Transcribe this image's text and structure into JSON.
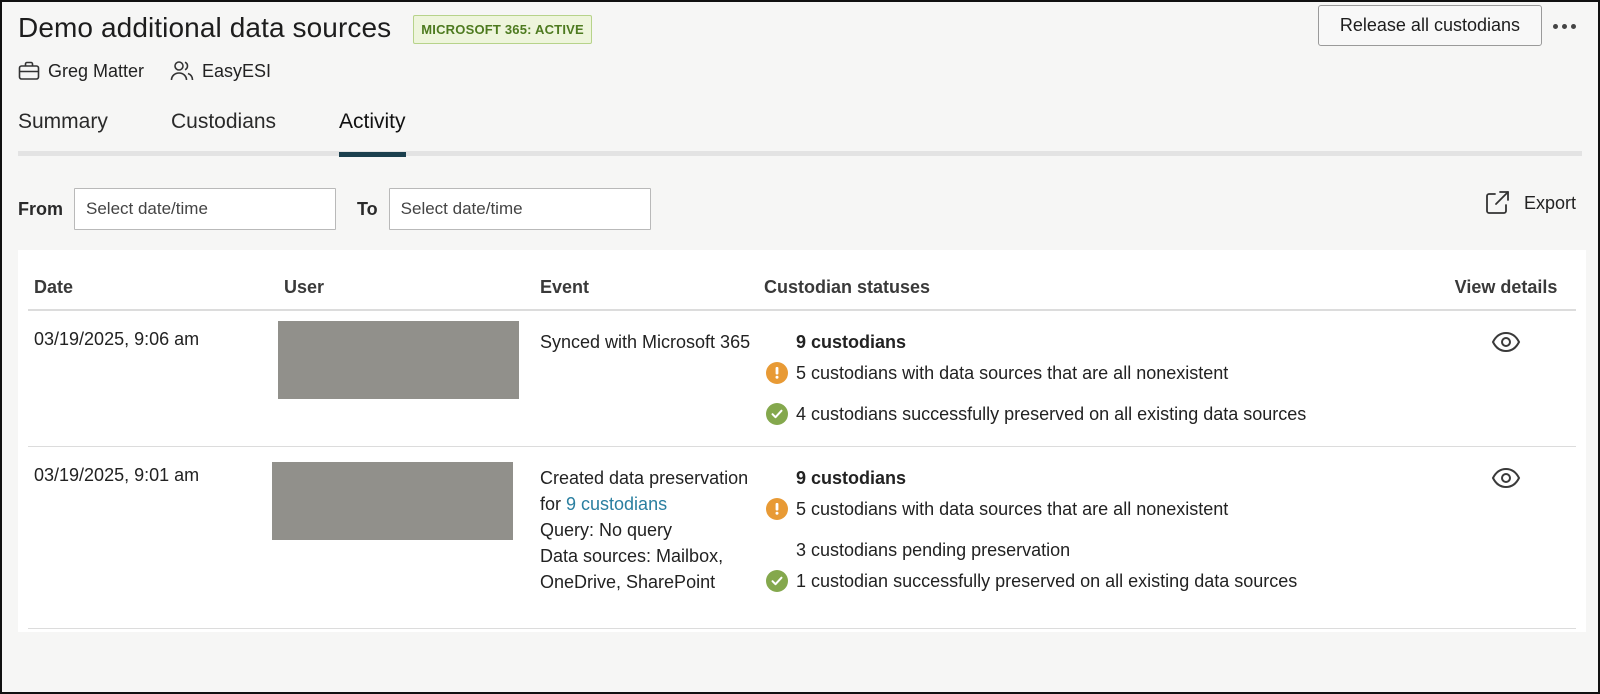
{
  "header": {
    "title": "Demo additional data sources",
    "badge": "MICROSOFT 365: ACTIVE",
    "release_label": "Release all custodians"
  },
  "meta": {
    "matter": "Greg Matter",
    "client": "EasyESI"
  },
  "tabs": [
    {
      "label": "Summary",
      "active": false
    },
    {
      "label": "Custodians",
      "active": false
    },
    {
      "label": "Activity",
      "active": true
    }
  ],
  "filters": {
    "from_label": "From",
    "from_placeholder": "Select date/time",
    "to_label": "To",
    "to_placeholder": "Select date/time",
    "export_label": "Export"
  },
  "table": {
    "columns": [
      "Date",
      "User",
      "Event",
      "Custodian statuses",
      "View details"
    ],
    "rows": [
      {
        "date": "03/19/2025, 9:06 am",
        "event_line1": "Synced with Microsoft 365",
        "statuses": {
          "title": "9 custodians",
          "warning": "5 custodians with data sources that are all nonexistent",
          "success": "4 custodians successfully preserved on all existing data sources"
        }
      },
      {
        "date": "03/19/2025, 9:01 am",
        "event_prefix": "Created data preservation for ",
        "event_link": "9 custodians",
        "event_query": "Query: No query",
        "event_sources": "Data sources: Mailbox, OneDrive, SharePoint",
        "statuses": {
          "title": "9 custodians",
          "warning": "5 custodians with data sources that are all nonexistent",
          "pending": "3 custodians pending preservation",
          "success": "1 custodian successfully preserved on all existing data sources"
        }
      }
    ]
  },
  "colors": {
    "accent_tab": "#1b3f4d",
    "warning": "#e89a35",
    "success": "#84a84d",
    "link": "#2a7fa0",
    "badge_text": "#4d7a1f"
  }
}
